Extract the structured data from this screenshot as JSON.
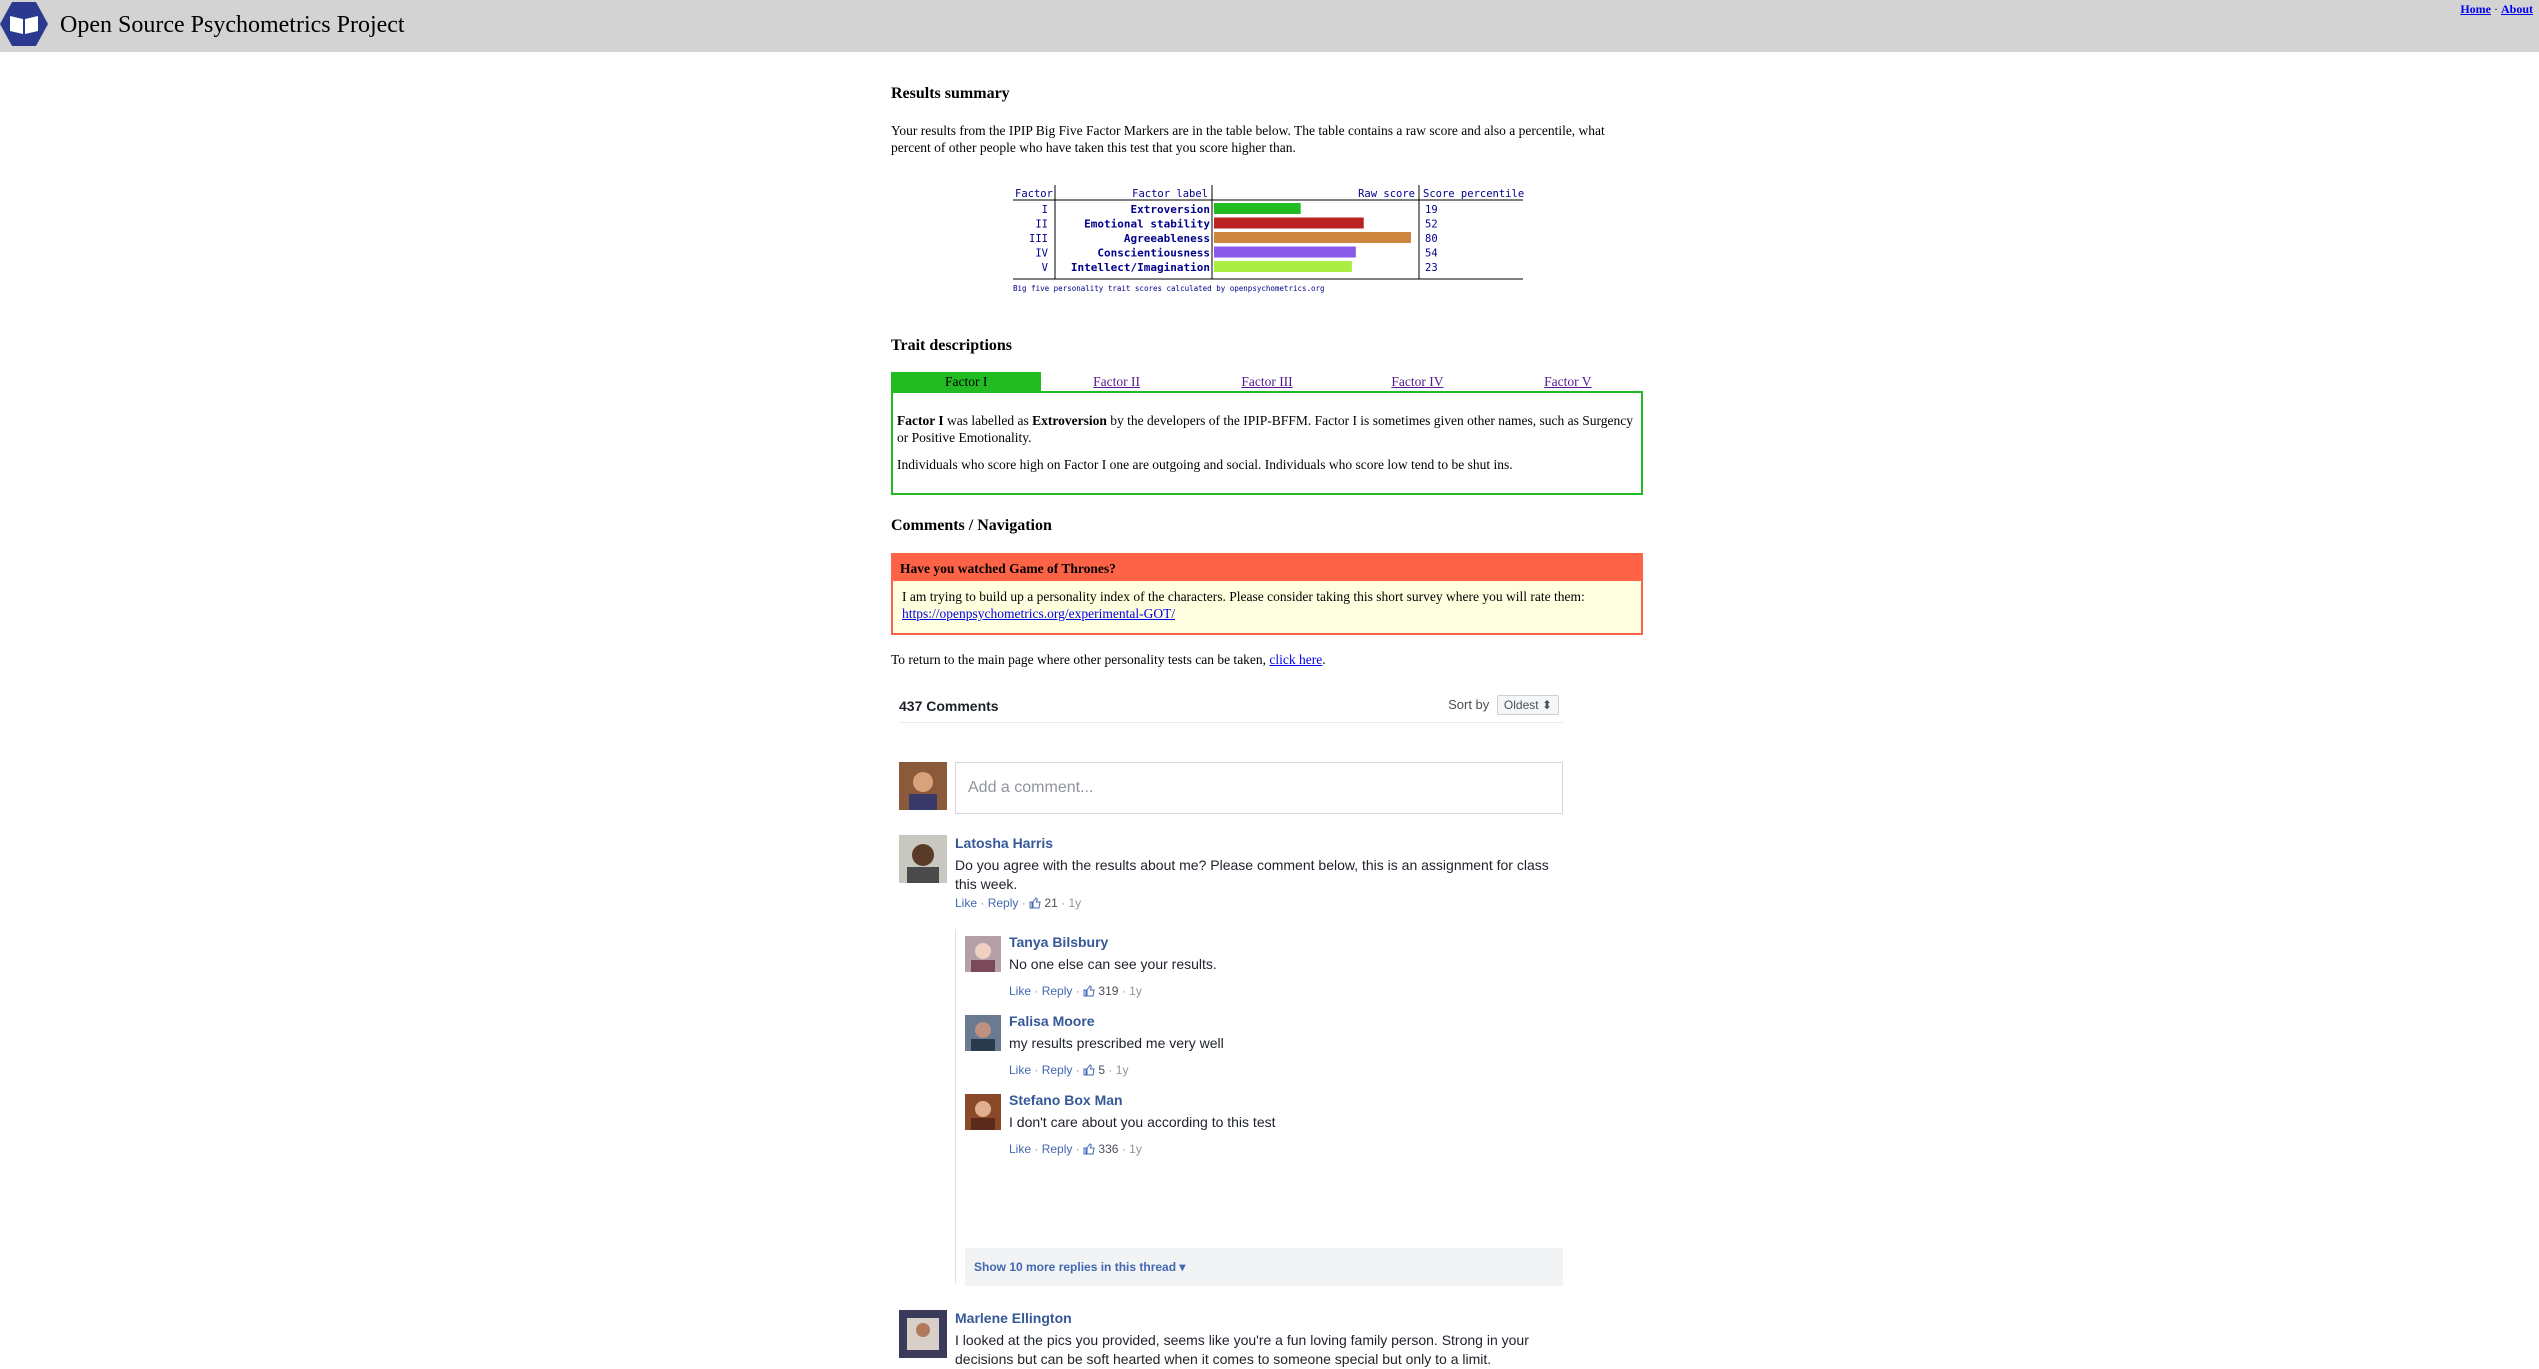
{
  "header": {
    "site_title": "Open Source Psychometrics Project",
    "links": {
      "home": "Home",
      "sep": "·",
      "about": "About"
    }
  },
  "results": {
    "heading": "Results summary",
    "intro": "Your results from the IPIP Big Five Factor Markers are in the table below. The table contains a raw score and also a percentile, what percent of other people who have taken this test that you score higher than."
  },
  "chart_data": {
    "type": "bar",
    "orientation": "horizontal",
    "columns": [
      "Factor",
      "Factor label",
      "Raw score",
      "Score percentile"
    ],
    "factors": [
      "I",
      "II",
      "III",
      "IV",
      "V"
    ],
    "categories": [
      "Extroversion",
      "Emotional stability",
      "Agreeableness",
      "Conscientiousness",
      "Intellect/Imagination"
    ],
    "values": [
      19,
      52,
      80,
      54,
      23
    ],
    "raw_scores": [
      22,
      38,
      50,
      36,
      35
    ],
    "colors": [
      "#22bb22",
      "#bb2222",
      "#cd853f",
      "#8a5be8",
      "#aaee44"
    ],
    "footer": "Big five personality trait scores calculated by openpsychometrics.org"
  },
  "traits": {
    "heading": "Trait descriptions",
    "tabs": [
      "Factor I",
      "Factor II",
      "Factor III",
      "Factor IV",
      "Factor V"
    ],
    "active_tab": 0,
    "p1_a": "Factor I",
    "p1_b": " was labelled as ",
    "p1_c": "Extroversion",
    "p1_d": " by the developers of the IPIP-BFFM. Factor I is sometimes given other names, such as Surgency or Positive Emotionality.",
    "p2": "Individuals who score high on Factor I one are outgoing and social. Individuals who score low tend to be shut ins."
  },
  "comments_nav": {
    "heading": "Comments / Navigation",
    "got_title": "Have you watched Game of Thrones?",
    "got_body": "I am trying to build up a personality index of the characters. Please consider taking this short survey where you will rate them:",
    "got_link": "https://openpsychometrics.org/experimental-GOT/",
    "return_text": "To return to the main page where other personality tests can be taken, ",
    "return_link": "click here",
    "return_end": "."
  },
  "fb": {
    "count": "437 Comments",
    "sort_label": "Sort by",
    "sort_value": "Oldest",
    "placeholder": "Add a comment...",
    "like": "Like",
    "reply": "Reply",
    "dot": "·",
    "comments": [
      {
        "name": "Latosha Harris",
        "text": "Do you agree with the results about me? Please comment below, this is an assignment for class this week.",
        "likes": "21",
        "age": "1y"
      },
      {
        "name": "Tanya Bilsbury",
        "text": "No one else can see your results.",
        "likes": "319",
        "age": "1y"
      },
      {
        "name": "Falisa Moore",
        "text": "my results prescribed me very well",
        "likes": "5",
        "age": "1y"
      },
      {
        "name": "Stefano Box Man",
        "text": "I don't care about you according to this test",
        "likes": "336",
        "age": "1y"
      },
      {
        "name": "Marlene Ellington",
        "text": "I looked at the pics you provided, seems like you're a fun loving family person. Strong in your decisions but can be soft hearted when it comes to someone special but only to a limit."
      }
    ],
    "more_replies": "Show 10 more replies in this thread"
  }
}
